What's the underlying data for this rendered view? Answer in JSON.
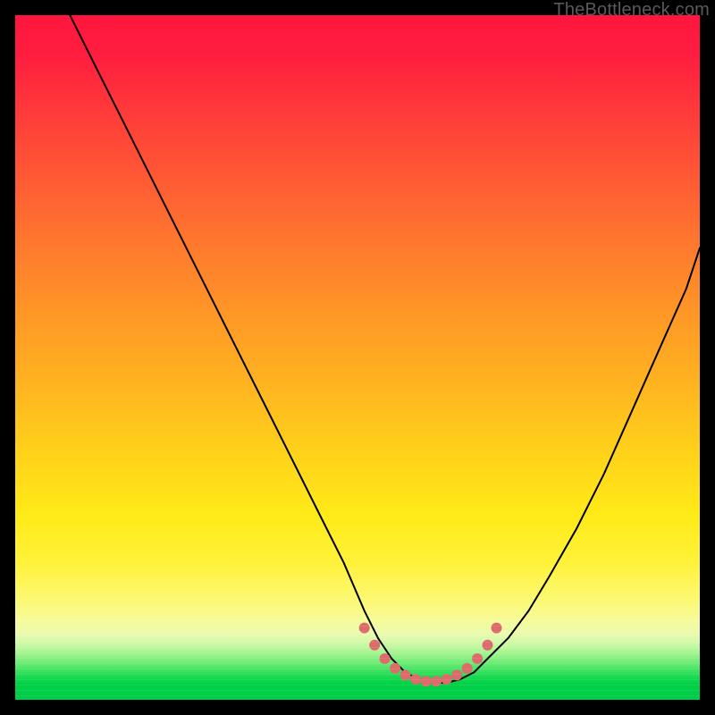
{
  "attribution": "TheBottleneck.com",
  "chart_data": {
    "type": "line",
    "title": "",
    "xlabel": "",
    "ylabel": "",
    "xlim": [
      0,
      100
    ],
    "ylim": [
      0,
      100
    ],
    "grid": false,
    "legend": false,
    "series": [
      {
        "name": "bottleneck-curve",
        "x": [
          8,
          12,
          16,
          20,
          24,
          28,
          32,
          36,
          40,
          44,
          48,
          51,
          53,
          55,
          57,
          59,
          61,
          63,
          65,
          67,
          69,
          72,
          75,
          78,
          82,
          86,
          90,
          94,
          98,
          100
        ],
        "y": [
          100,
          92,
          84,
          76,
          68,
          60,
          52,
          44,
          36,
          28,
          20,
          13,
          9,
          6,
          4,
          3,
          2.5,
          2.5,
          3,
          4,
          6,
          9,
          13,
          18,
          25,
          33,
          42,
          51,
          60,
          66
        ],
        "_interpretation": "x is horizontal position percent of plot width; y is vertical position percent where 0 is bottom and 100 is top. Curve is a V-shape with flat rounded minimum around x=58-66, left arm reaching top-left corner and right arm exiting mid-right."
      },
      {
        "name": "highlight-dots",
        "color": "#de6b6b",
        "x": [
          51.0,
          52.5,
          54.0,
          55.5,
          57.0,
          58.5,
          60.0,
          61.5,
          63.0,
          64.5,
          66.0,
          67.5,
          69.0,
          70.3
        ],
        "y": [
          10.5,
          8.0,
          6.0,
          4.6,
          3.6,
          3.0,
          2.7,
          2.7,
          3.0,
          3.6,
          4.6,
          6.0,
          8.0,
          10.5
        ],
        "_interpretation": "cluster of pink marker dots along the trough of the curve"
      }
    ],
    "background": {
      "type": "vertical-gradient",
      "stops": [
        {
          "pos": 0.0,
          "color": "#ff163e"
        },
        {
          "pos": 0.34,
          "color": "#ff7a2e"
        },
        {
          "pos": 0.64,
          "color": "#ffd21a"
        },
        {
          "pos": 0.88,
          "color": "#f7fb9a"
        },
        {
          "pos": 1.0,
          "color": "#00cc48"
        }
      ]
    }
  }
}
